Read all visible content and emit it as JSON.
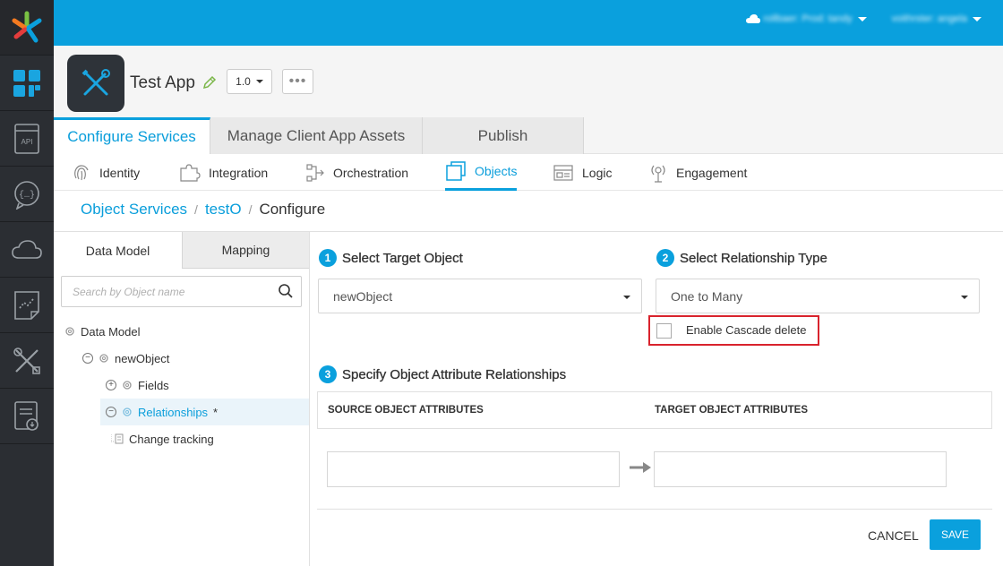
{
  "rail": {
    "items": [
      {
        "icon": "dashboard-icon"
      },
      {
        "icon": "api-icon",
        "text": "API"
      },
      {
        "icon": "chat-code-icon"
      },
      {
        "icon": "cloud-icon"
      },
      {
        "icon": "analytics-icon"
      },
      {
        "icon": "tools-icon"
      },
      {
        "icon": "report-icon"
      }
    ]
  },
  "topbar": {
    "account": "rollbaer: Prod: tandy",
    "user": "voithrster: angela"
  },
  "app": {
    "title": "Test App",
    "version": "1.0",
    "more": "•••"
  },
  "main_tabs": [
    "Configure Services",
    "Manage Client App Assets",
    "Publish"
  ],
  "sub_tabs": [
    "Identity",
    "Integration",
    "Orchestration",
    "Objects",
    "Logic",
    "Engagement"
  ],
  "breadcrumb": {
    "root": "Object Services",
    "sep": "/",
    "service": "testO",
    "current": "Configure"
  },
  "left_panel": {
    "tabs": [
      "Data Model",
      "Mapping"
    ],
    "search_placeholder": "Search by Object name",
    "tree": {
      "root": "Data Model",
      "object": "newObject",
      "fields": "Fields",
      "relationships": "Relationships",
      "relationships_mark": "*",
      "change_tracking": "Change tracking"
    }
  },
  "right_panel": {
    "step1": {
      "num": "1",
      "label": "Select Target Object",
      "value": "newObject"
    },
    "step2": {
      "num": "2",
      "label": "Select Relationship Type",
      "value": "One to Many"
    },
    "cascade_label": "Enable Cascade delete",
    "step3": {
      "num": "3",
      "label": "Specify Object Attribute Relationships"
    },
    "source_header": "SOURCE OBJECT ATTRIBUTES",
    "target_header": "TARGET OBJECT ATTRIBUTES",
    "cancel": "CANCEL",
    "save": "SAVE"
  },
  "colors": {
    "accent": "#0aa0dd",
    "highlight": "#d9232d",
    "rail": "#2b2e33"
  }
}
